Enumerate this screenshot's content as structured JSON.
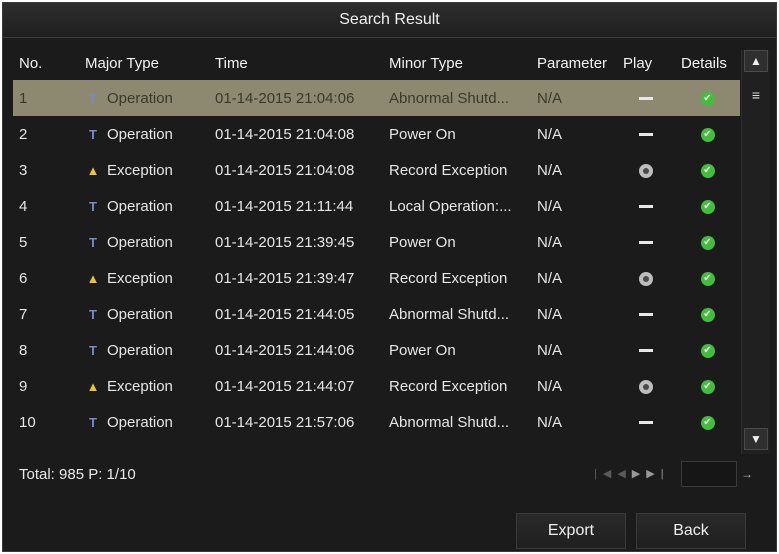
{
  "dialog": {
    "title": "Search Result"
  },
  "table": {
    "headers": [
      "No.",
      "Major Type",
      "Time",
      "Minor Type",
      "Parameter",
      "Play",
      "Details"
    ],
    "rows": [
      {
        "no": "1",
        "major": "Operation",
        "time": "01-14-2015 21:04:06",
        "minor": "Abnormal Shutd...",
        "param": "N/A",
        "play": "none",
        "selected": true
      },
      {
        "no": "2",
        "major": "Operation",
        "time": "01-14-2015 21:04:08",
        "minor": "Power On",
        "param": "N/A",
        "play": "none"
      },
      {
        "no": "3",
        "major": "Exception",
        "time": "01-14-2015 21:04:08",
        "minor": "Record Exception",
        "param": "N/A",
        "play": "play"
      },
      {
        "no": "4",
        "major": "Operation",
        "time": "01-14-2015 21:11:44",
        "minor": "Local Operation:...",
        "param": "N/A",
        "play": "none"
      },
      {
        "no": "5",
        "major": "Operation",
        "time": "01-14-2015 21:39:45",
        "minor": "Power On",
        "param": "N/A",
        "play": "none"
      },
      {
        "no": "6",
        "major": "Exception",
        "time": "01-14-2015 21:39:47",
        "minor": "Record Exception",
        "param": "N/A",
        "play": "play"
      },
      {
        "no": "7",
        "major": "Operation",
        "time": "01-14-2015 21:44:05",
        "minor": "Abnormal Shutd...",
        "param": "N/A",
        "play": "none"
      },
      {
        "no": "8",
        "major": "Operation",
        "time": "01-14-2015 21:44:06",
        "minor": "Power On",
        "param": "N/A",
        "play": "none"
      },
      {
        "no": "9",
        "major": "Exception",
        "time": "01-14-2015 21:44:07",
        "minor": "Record Exception",
        "param": "N/A",
        "play": "play"
      },
      {
        "no": "10",
        "major": "Operation",
        "time": "01-14-2015 21:57:06",
        "minor": "Abnormal Shutd...",
        "param": "N/A",
        "play": "none"
      }
    ],
    "icons": {
      "operation": "operation-icon",
      "exception": "warning-icon",
      "play": "play-icon",
      "no_play": "dash-icon",
      "details": "check-icon"
    }
  },
  "footer": {
    "total_text": "Total: 985  P: 1/10"
  },
  "buttons": {
    "export": "Export",
    "back": "Back"
  },
  "colors": {
    "selected_row": "#8c8970",
    "operation_icon": "#6c8fc7",
    "exception_icon": "#f2c02b",
    "details_icon": "#3fbf3a"
  }
}
